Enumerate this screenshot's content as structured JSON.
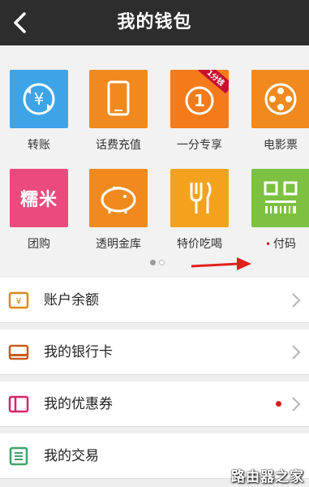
{
  "header": {
    "title": "我的钱包"
  },
  "grid": {
    "row1": [
      {
        "label": "转账",
        "color": "#3ea4e8",
        "icon": "transfer-icon"
      },
      {
        "label": "话费充值",
        "color": "#f08a1e",
        "icon": "phone-icon"
      },
      {
        "label": "一分专享",
        "color": "#f47a1a",
        "icon": "one-cent-icon",
        "badge": "1分钱"
      },
      {
        "label": "电影票",
        "color": "#f08a1e",
        "icon": "film-reel-icon"
      }
    ],
    "row2": [
      {
        "label": "团购",
        "color": "#ea4a7e",
        "icon": "group-buy-icon",
        "icon_text": "糯米"
      },
      {
        "label": "透明金库",
        "color": "#f08a1e",
        "icon": "piggy-bank-icon"
      },
      {
        "label": "特价吃喝",
        "color": "#f4a21e",
        "icon": "fork-icon"
      },
      {
        "label": "付码",
        "color": "#7cc142",
        "icon": "qr-code-icon",
        "dot": "•"
      }
    ],
    "pager_active_color": "#9a9a9a"
  },
  "list": [
    {
      "label": "账户余额",
      "icon": "wallet-icon",
      "color": "#d98a1f"
    },
    {
      "label": "我的银行卡",
      "icon": "bank-card-icon",
      "color": "#c95a1e"
    },
    {
      "label": "我的优惠券",
      "icon": "coupon-icon",
      "color": "#d6246b",
      "has_dot": true
    },
    {
      "label": "我的交易",
      "icon": "transactions-icon",
      "color": "#3fa16a"
    }
  ],
  "watermark": "路由器之家",
  "accent_red": "#d0201f"
}
